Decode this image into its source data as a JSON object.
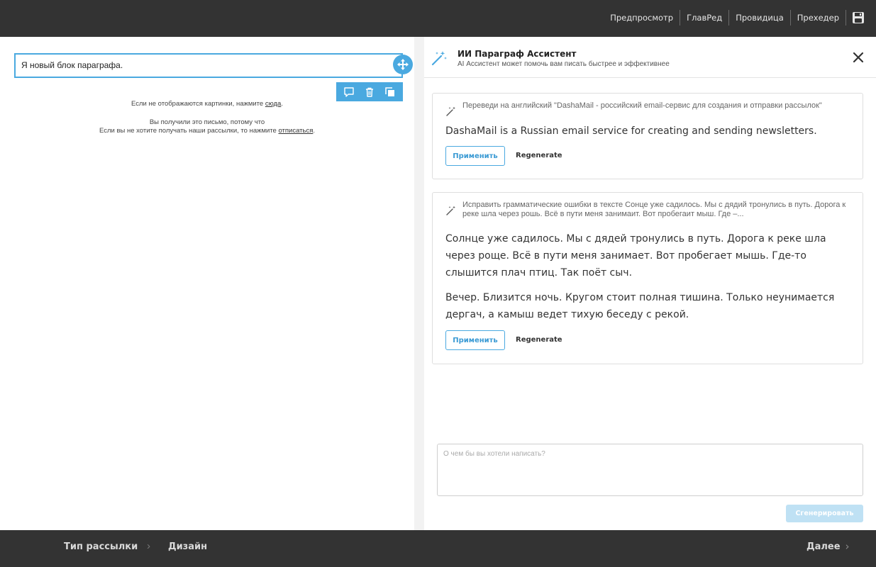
{
  "topbar": {
    "nav": [
      "Предпросмотр",
      "ГлавРед",
      "Провидица",
      "Прехедер"
    ],
    "save_icon": "floppy-disk-icon"
  },
  "editor": {
    "paragraph_text": "Я новый блок параграфа.",
    "toolbar_icons": [
      "comment-icon",
      "trash-icon",
      "duplicate-icon"
    ],
    "footer": {
      "images_prefix": "Если не отображаются картинки, нажмите ",
      "images_link": "сюда",
      "images_suffix": ".",
      "reason": "Вы получили это письмо, потому что",
      "unsub_prefix": "Если вы не хотите получать наши рассылки, то нажмите ",
      "unsub_link": "отписаться",
      "unsub_suffix": "."
    }
  },
  "assistant": {
    "title": "ИИ Параграф Ассистент",
    "subtitle": "AI Ассистент может помочь вам писать быстрее и эффективнее",
    "cards": [
      {
        "prompt": "Переведи на английский \"DashaMail - российский email-сервис для создания и отправки рассылок\"",
        "result": [
          "DashaMail is a Russian email service for creating and sending newsletters."
        ],
        "apply_label": "Применить",
        "regenerate_label": "Regenerate"
      },
      {
        "prompt": "Исправить грамматические ошибки в тексте Сонце уже садилось. Мы с дядий тронулись в путь. Дорога к реке шла через рошь. Всё в пути меня занимаит. Вот пробегаит мыш. Где –...",
        "result": [
          "Солнце уже садилось. Мы с дядей тронулись в путь. Дорога к реке шла через роще. Всё в пути меня занимает. Вот пробегает мышь. Где-то слышится плач птиц. Так поёт сыч.",
          "Вечер. Близится ночь. Кругом стоит полная тишина. Только неунимается дергач, а камыш ведет тихую беседу с рекой."
        ],
        "apply_label": "Применить",
        "regenerate_label": "Regenerate"
      }
    ],
    "input_placeholder": "О чем бы вы хотели написать?",
    "generate_label": "Сгенерировать"
  },
  "bottombar": {
    "breadcrumb": [
      "Тип рассылки",
      "Дизайн"
    ],
    "next_label": "Далее"
  },
  "colors": {
    "accent": "#4aa9e0",
    "bar": "#333333",
    "generate_disabled": "#bfe1f4"
  }
}
